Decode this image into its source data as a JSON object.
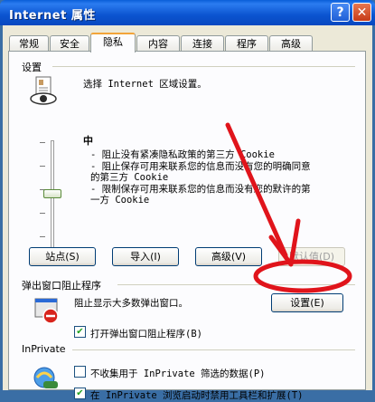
{
  "window": {
    "title": "Internet 属性",
    "help_glyph": "?",
    "close_glyph": "✕"
  },
  "tabs": [
    {
      "label": "常规"
    },
    {
      "label": "安全"
    },
    {
      "label": "隐私",
      "active": true
    },
    {
      "label": "内容"
    },
    {
      "label": "连接"
    },
    {
      "label": "程序"
    },
    {
      "label": "高级"
    }
  ],
  "settings": {
    "group_label": "设置",
    "prompt": "选择 Internet 区域设置。",
    "level": "中",
    "bullets": [
      "- 阻止没有紧凑隐私政策的第三方 Cookie",
      "- 阻止保存可用来联系您的信息而没有您的明确同意",
      "的第三方 Cookie",
      "- 限制保存可用来联系您的信息而没有您的默许的第",
      "一方 Cookie"
    ],
    "buttons": {
      "sites": "站点(S)",
      "import": "导入(I)",
      "advanced": "高级(V)",
      "default": "默认值(D)"
    }
  },
  "popup": {
    "group_label": "弹出窗口阻止程序",
    "description": "阻止显示大多数弹出窗口。",
    "settings_button": "设置(E)",
    "enable_checkbox": {
      "label": "打开弹出窗口阻止程序(B)",
      "checked": true
    }
  },
  "inprivate": {
    "group_label": "InPrivate",
    "option1": {
      "label": "不收集用于 InPrivate 筛选的数据(P)",
      "checked": false
    },
    "option2": {
      "label": "在 InPrivate 浏览启动时禁用工具栏和扩展(T)",
      "checked": true
    }
  },
  "annotation": {
    "color": "#e0141b"
  }
}
